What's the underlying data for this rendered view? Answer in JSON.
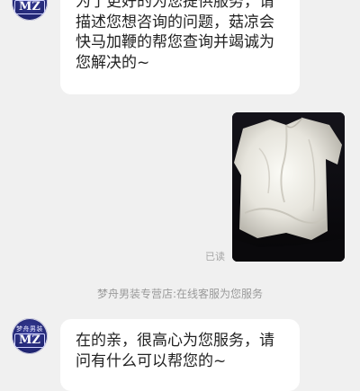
{
  "shop": {
    "avatar_top_text": "梦舟男装",
    "avatar_logo_text": "MZ"
  },
  "messages": [
    {
      "lines": [
        "为了更好的为您提供服务，请",
        "描述您想咨询的问题，菇凉会",
        "快马加鞭的帮您查询并竭诚为",
        "您解决的~"
      ]
    },
    {
      "lines": [
        "在的亲，很高心为您服务，请",
        "问有什么可以帮您的~"
      ]
    }
  ],
  "photo_message": {
    "status": "已读",
    "image_description": "white-shirt-photo"
  },
  "system_note": "梦舟男装专营店:在线客服为您服务",
  "colors": {
    "background": "#f0f0f0",
    "bubble": "#ffffff",
    "avatar": "#1f2470",
    "muted_text": "#9a9a9a"
  }
}
